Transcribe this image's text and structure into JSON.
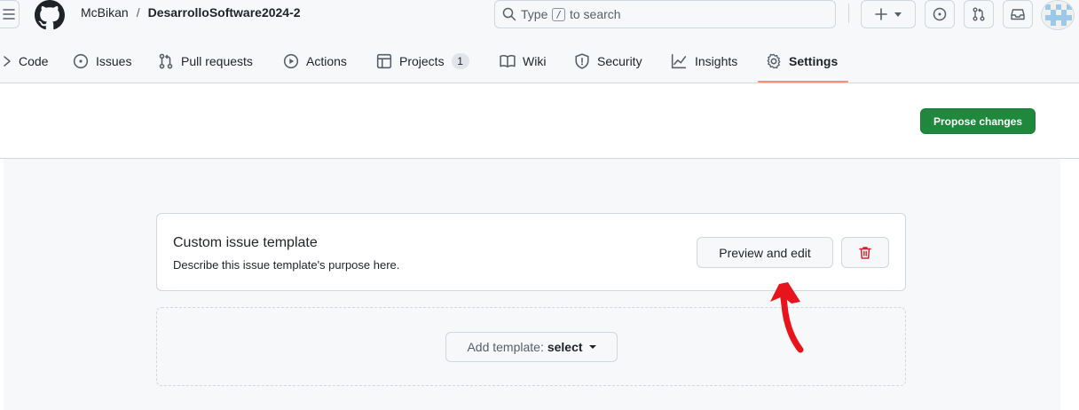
{
  "header": {
    "owner": "McBikan",
    "separator": "/",
    "repo": "DesarrolloSoftware2024-2",
    "search": {
      "prefix": "Type",
      "key": "/",
      "suffix": "to search"
    }
  },
  "repo_nav": {
    "items": [
      {
        "label": "Code",
        "icon": "code-icon"
      },
      {
        "label": "Issues",
        "icon": "issue-opened-icon"
      },
      {
        "label": "Pull requests",
        "icon": "git-pull-request-icon"
      },
      {
        "label": "Actions",
        "icon": "play-icon"
      },
      {
        "label": "Projects",
        "icon": "table-icon",
        "counter": "1"
      },
      {
        "label": "Wiki",
        "icon": "book-icon"
      },
      {
        "label": "Security",
        "icon": "shield-icon"
      },
      {
        "label": "Insights",
        "icon": "graph-icon"
      },
      {
        "label": "Settings",
        "icon": "gear-icon",
        "active": true
      }
    ]
  },
  "toolbar": {
    "propose_label": "Propose changes"
  },
  "template": {
    "title": "Custom issue template",
    "description": "Describe this issue template's purpose here.",
    "preview_label": "Preview and edit"
  },
  "add_template": {
    "prefix": "Add template:",
    "value": "select"
  },
  "colors": {
    "primary_green": "#1f883d",
    "danger_red": "#cf222e",
    "active_tab_underline": "#fd8c73",
    "annotation_red": "#e8141b"
  }
}
